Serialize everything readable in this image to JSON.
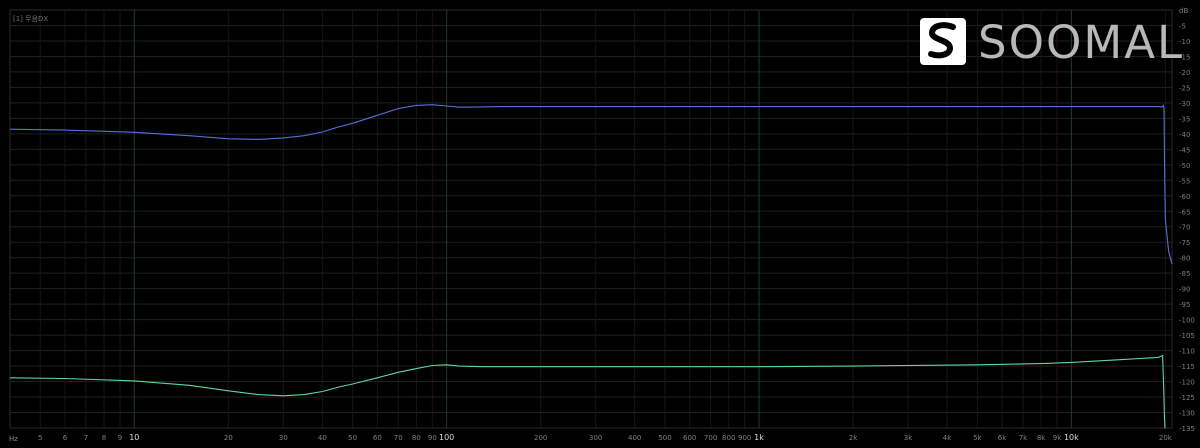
{
  "chart_data": {
    "type": "line",
    "x_scale": "log",
    "y_unit": "dB",
    "corner_label": "[1] 무음DX",
    "x_unit_label": "Hz",
    "xlim": [
      4,
      21000
    ],
    "ylim": [
      -135,
      0
    ],
    "y_ticks": [
      -5,
      -10,
      -15,
      -20,
      -25,
      -30,
      -35,
      -40,
      -45,
      -50,
      -55,
      -60,
      -65,
      -70,
      -75,
      -80,
      -85,
      -90,
      -95,
      -100,
      -105,
      -110,
      -115,
      -120,
      -125,
      -130,
      -135
    ],
    "y_top_label": "dB",
    "x_ticks": [
      {
        "v": 5,
        "t": "5"
      },
      {
        "v": 6,
        "t": "6"
      },
      {
        "v": 7,
        "t": "7"
      },
      {
        "v": 8,
        "t": "8"
      },
      {
        "v": 9,
        "t": "9"
      },
      {
        "v": 10,
        "t": "10",
        "major": true
      },
      {
        "v": 20,
        "t": "20"
      },
      {
        "v": 30,
        "t": "30"
      },
      {
        "v": 40,
        "t": "40"
      },
      {
        "v": 50,
        "t": "50"
      },
      {
        "v": 60,
        "t": "60"
      },
      {
        "v": 70,
        "t": "70"
      },
      {
        "v": 80,
        "t": "80"
      },
      {
        "v": 90,
        "t": "90"
      },
      {
        "v": 100,
        "t": "100",
        "major": true
      },
      {
        "v": 200,
        "t": "200"
      },
      {
        "v": 300,
        "t": "300"
      },
      {
        "v": 400,
        "t": "400"
      },
      {
        "v": 500,
        "t": "500"
      },
      {
        "v": 600,
        "t": "600"
      },
      {
        "v": 700,
        "t": "700"
      },
      {
        "v": 800,
        "t": "800"
      },
      {
        "v": 900,
        "t": "900"
      },
      {
        "v": 1000,
        "t": "1k",
        "major": true
      },
      {
        "v": 2000,
        "t": "2k"
      },
      {
        "v": 3000,
        "t": "3k"
      },
      {
        "v": 4000,
        "t": "4k"
      },
      {
        "v": 5000,
        "t": "5k"
      },
      {
        "v": 6000,
        "t": "6k"
      },
      {
        "v": 7000,
        "t": "7k"
      },
      {
        "v": 8000,
        "t": "8k"
      },
      {
        "v": 9000,
        "t": "9k"
      },
      {
        "v": 10000,
        "t": "10k",
        "major": true
      },
      {
        "v": 20000,
        "t": "20k"
      }
    ],
    "series": [
      {
        "color": "#5a6fd8",
        "x": [
          4,
          6,
          10,
          15,
          20,
          25,
          30,
          35,
          40,
          45,
          50,
          60,
          70,
          80,
          90,
          100,
          110,
          130,
          150,
          200,
          500,
          1000,
          5000,
          10000,
          15000,
          19000,
          19500,
          19700,
          19800,
          19900,
          20000,
          20500,
          21000
        ],
        "y": [
          -38.5,
          -38.8,
          -39.5,
          -40.6,
          -41.6,
          -41.8,
          -41.3,
          -40.6,
          -39.4,
          -37.8,
          -36.6,
          -34,
          -31.8,
          -30.8,
          -30.6,
          -31,
          -31.4,
          -31.3,
          -31.2,
          -31.2,
          -31.2,
          -31.2,
          -31.2,
          -31.2,
          -31.2,
          -31.2,
          -31.3,
          -30.8,
          -31.5,
          -55,
          -68,
          -78,
          -82
        ]
      },
      {
        "color": "#5dd6a2",
        "x": [
          4,
          6,
          10,
          15,
          20,
          25,
          30,
          35,
          40,
          45,
          50,
          60,
          70,
          80,
          90,
          100,
          110,
          130,
          150,
          200,
          500,
          1000,
          2000,
          5000,
          8000,
          10000,
          15000,
          19000,
          19600,
          19750,
          19850,
          19950,
          20000
        ],
        "y": [
          -118.8,
          -119,
          -119.8,
          -121.2,
          -123,
          -124.2,
          -124.6,
          -124.2,
          -123.2,
          -121.8,
          -120.8,
          -118.8,
          -117,
          -115.8,
          -114.8,
          -114.6,
          -115,
          -115.2,
          -115.2,
          -115.2,
          -115.2,
          -115.2,
          -115,
          -114.6,
          -114.2,
          -113.8,
          -112.8,
          -112.2,
          -111.6,
          -122,
          -131,
          -135,
          -135
        ]
      }
    ],
    "legend_colors": [
      "#d42222",
      "#d87a1e",
      "#d6cf36",
      "#5fbf33",
      "#3aa86a",
      "#2fbfcf",
      "#3d6fd8",
      "#c032c8"
    ]
  },
  "logo": {
    "text": "SOOMAL"
  }
}
